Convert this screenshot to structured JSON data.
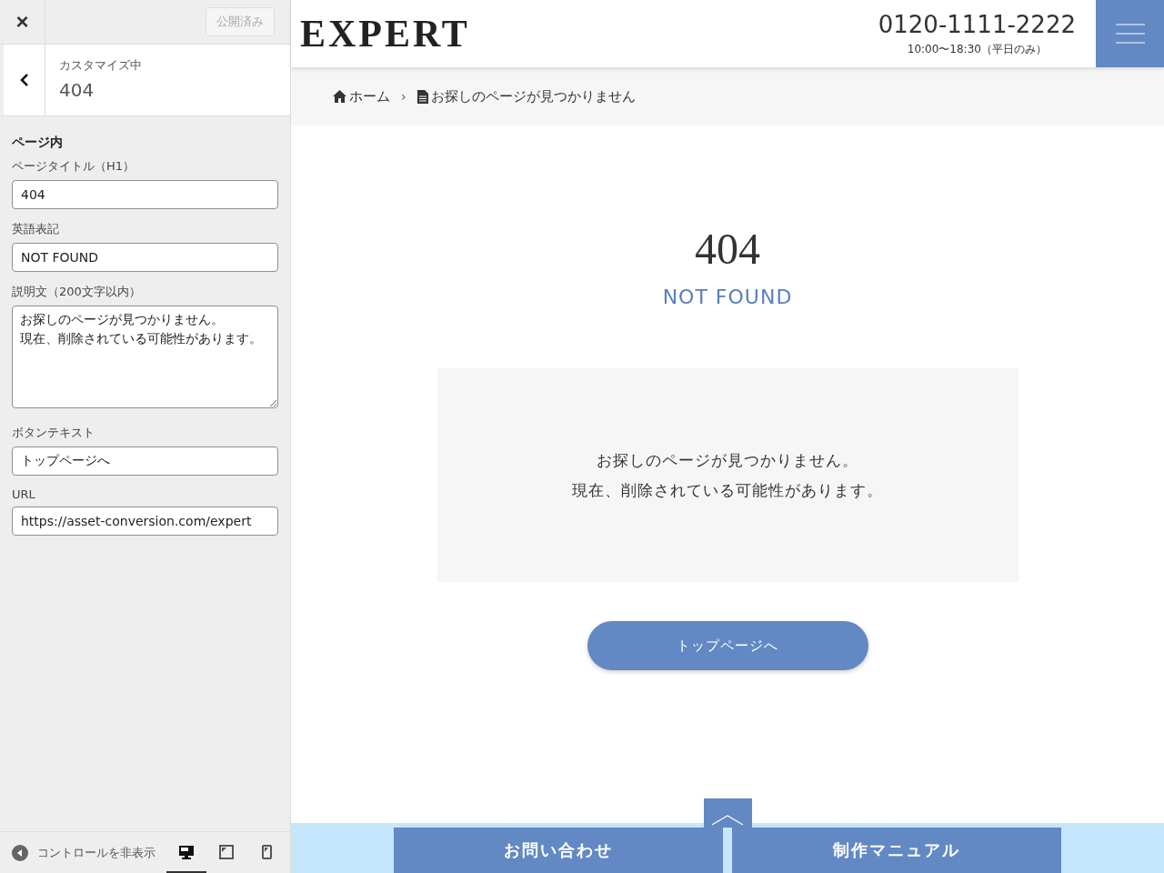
{
  "sidebar": {
    "close": "×",
    "publish_button": "公開済み",
    "section_title": "カスタマイズ中",
    "section_name": "404",
    "group_title": "ページ内",
    "fields": [
      {
        "label": "ページタイトル（H1）",
        "kind": "input",
        "value": "404"
      },
      {
        "label": "英語表記",
        "kind": "input",
        "value": "NOT FOUND"
      },
      {
        "label": "説明文（200文字以内）",
        "kind": "textarea",
        "value_lines": [
          "お探しのページが見つかりません。",
          "現在、削除されている可能性があります。"
        ]
      },
      {
        "label": "ボタンテキスト",
        "kind": "input",
        "value": "トップページへ"
      },
      {
        "label": "URL",
        "kind": "input",
        "value": "https://asset-conversion.com/expert"
      }
    ],
    "hide_controls": "コントロールを非表示",
    "devices": [
      {
        "kind": "desktop",
        "selected": true
      },
      {
        "kind": "tablet",
        "selected": false
      },
      {
        "kind": "mobile",
        "selected": false
      }
    ]
  },
  "header": {
    "logo": "EXPERT",
    "phone": "0120-1111-2222",
    "hours": "10:00〜18:30（平日のみ）"
  },
  "breadcrumb": [
    {
      "kind": "home",
      "label": "ホーム"
    },
    {
      "kind": "page",
      "label": "お探しのページが見つかりません"
    }
  ],
  "breadcrumb_separator": "›",
  "content": {
    "title": "404",
    "subtitle": "NOT FOUND",
    "message_lines": [
      "お探しのページが見つかりません。",
      "現在、削除されている可能性があります。"
    ],
    "button": "トップページへ"
  },
  "footer": {
    "buttons": [
      "お問い合わせ",
      "制作マニュアル"
    ]
  }
}
